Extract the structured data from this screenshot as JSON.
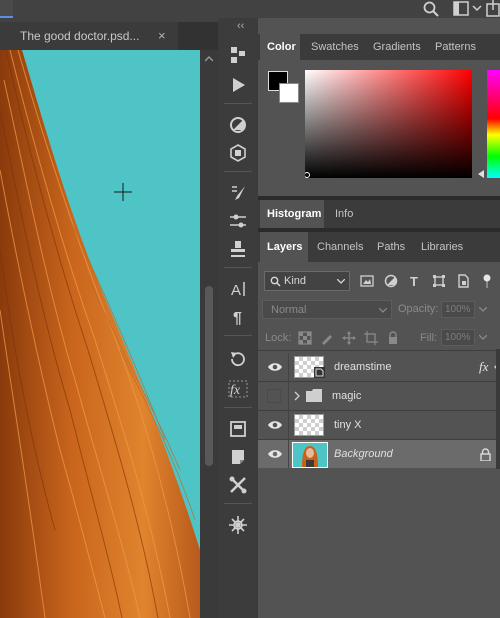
{
  "document": {
    "tab_title": "The good doctor.psd...",
    "close_glyph": "×"
  },
  "tools_collapse_glyph": "‹‹",
  "tools": [
    {
      "name": "history-brush-icon"
    },
    {
      "name": "play-action-icon"
    },
    {
      "name": "adjustment-icon"
    },
    {
      "name": "3d-icon"
    },
    {
      "name": "brush-preset-icon"
    },
    {
      "name": "brush-settings-icon"
    },
    {
      "name": "clone-source-icon"
    },
    {
      "name": "character-icon"
    },
    {
      "name": "paragraph-icon"
    },
    {
      "name": "history-icon"
    },
    {
      "name": "fx-icon"
    },
    {
      "name": "layer-comps-icon"
    },
    {
      "name": "notes-icon"
    },
    {
      "name": "tools-customize-icon"
    },
    {
      "name": "settings-wheel-icon"
    }
  ],
  "color_panel": {
    "tabs": [
      "Color",
      "Swatches",
      "Gradients",
      "Patterns"
    ],
    "active_tab": "Color",
    "foreground_color": "#000000",
    "background_color": "#ffffff"
  },
  "histogram_panel": {
    "tabs": [
      "Histogram",
      "Info"
    ],
    "active_tab": "Histogram"
  },
  "layers_panel": {
    "tabs": [
      "Layers",
      "Channels",
      "Paths",
      "Libraries"
    ],
    "active_tab": "Layers",
    "filter_kind": "Kind",
    "blend_mode": "Normal",
    "opacity_label": "Opacity:",
    "opacity_value": "100%",
    "lock_label": "Lock:",
    "fill_label": "Fill:",
    "fill_value": "100%",
    "fx_badge": "fx",
    "layers": [
      {
        "name": "dreamstime",
        "visible": true,
        "type": "smart"
      },
      {
        "name": "magic",
        "visible": false,
        "type": "group"
      },
      {
        "name": "tiny X",
        "visible": true,
        "type": "pixel"
      },
      {
        "name": "Background",
        "visible": true,
        "type": "image",
        "locked": true,
        "selected": true
      }
    ]
  },
  "colors": {
    "canvas_background": "#4ec4c6",
    "hair": "#c8621b",
    "accent": "#5a8ee6"
  }
}
